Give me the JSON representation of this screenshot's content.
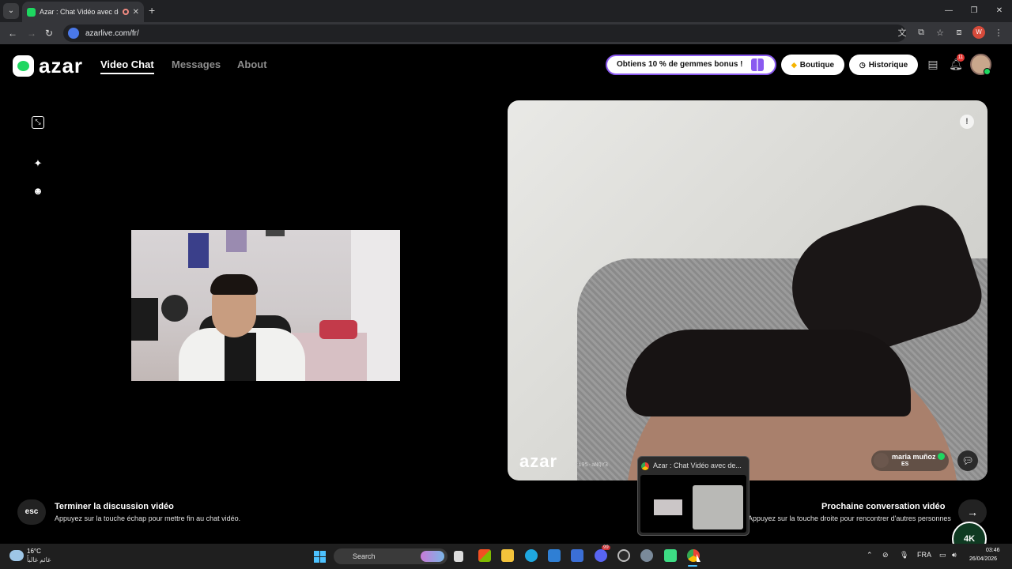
{
  "browser": {
    "tab_title": "Azar : Chat Vidéo avec de n",
    "url": "azarlive.com/fr/",
    "profile_initial": "W"
  },
  "app": {
    "logo": "azar",
    "nav": [
      "Video Chat",
      "Messages",
      "About"
    ],
    "promo": "Obtiens 10 % de gemmes bonus !",
    "shop": "Boutique",
    "history": "Historique",
    "notification_count": "11"
  },
  "video": {
    "watermark": "azar",
    "session_id": "fi95-aNQY3",
    "peer_name": "maria muñoz",
    "peer_country": "ES"
  },
  "hints": {
    "esc_key": "esc",
    "end_title": "Terminer la discussion vidéo",
    "end_sub": "Appuyez sur la touche échap pour mettre fin au chat vidéo.",
    "next_title": "Prochaine conversation vidéo",
    "next_sub": "Appuyez sur la touche droite pour rencontrer d'autres personnes"
  },
  "thumbnail": {
    "title": "Azar : Chat Vidéo avec de..."
  },
  "taskbar": {
    "weather_temp": "16°C",
    "weather_desc": "غائم غالباً",
    "search_placeholder": "Search",
    "chat_badge": "99",
    "language": "FRA",
    "time": "03:46",
    "date": "26/04/2026"
  },
  "overlay": {
    "label": "4K"
  },
  "colors": {
    "brand_green": "#1ed760",
    "promo_purple": "#8a59f0"
  }
}
